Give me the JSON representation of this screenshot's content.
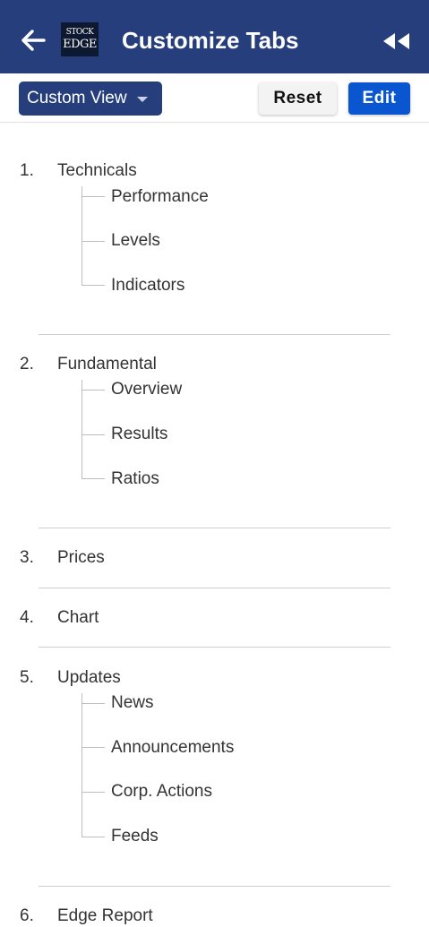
{
  "header": {
    "title": "Customize Tabs",
    "logo_line1": "STOCK",
    "logo_line2": "EDGE",
    "back_icon": "arrow-left-icon",
    "rewind_icon": "double-chevron-left-icon"
  },
  "toolbar": {
    "view_select": "Custom View",
    "reset_label": "Reset",
    "edit_label": "Edit"
  },
  "colors": {
    "header_bg": "#263f7c",
    "edit_button": "#0a56d0"
  },
  "tabs": [
    {
      "num": "1.",
      "name": "Technicals",
      "children": [
        "Performance",
        "Levels",
        "Indicators"
      ]
    },
    {
      "num": "2.",
      "name": "Fundamental",
      "children": [
        "Overview",
        "Results",
        "Ratios"
      ]
    },
    {
      "num": "3.",
      "name": "Prices",
      "children": []
    },
    {
      "num": "4.",
      "name": "Chart",
      "children": []
    },
    {
      "num": "5.",
      "name": "Updates",
      "children": [
        "News",
        "Announcements",
        "Corp. Actions",
        "Feeds"
      ]
    },
    {
      "num": "6.",
      "name": "Edge Report",
      "children": []
    }
  ]
}
